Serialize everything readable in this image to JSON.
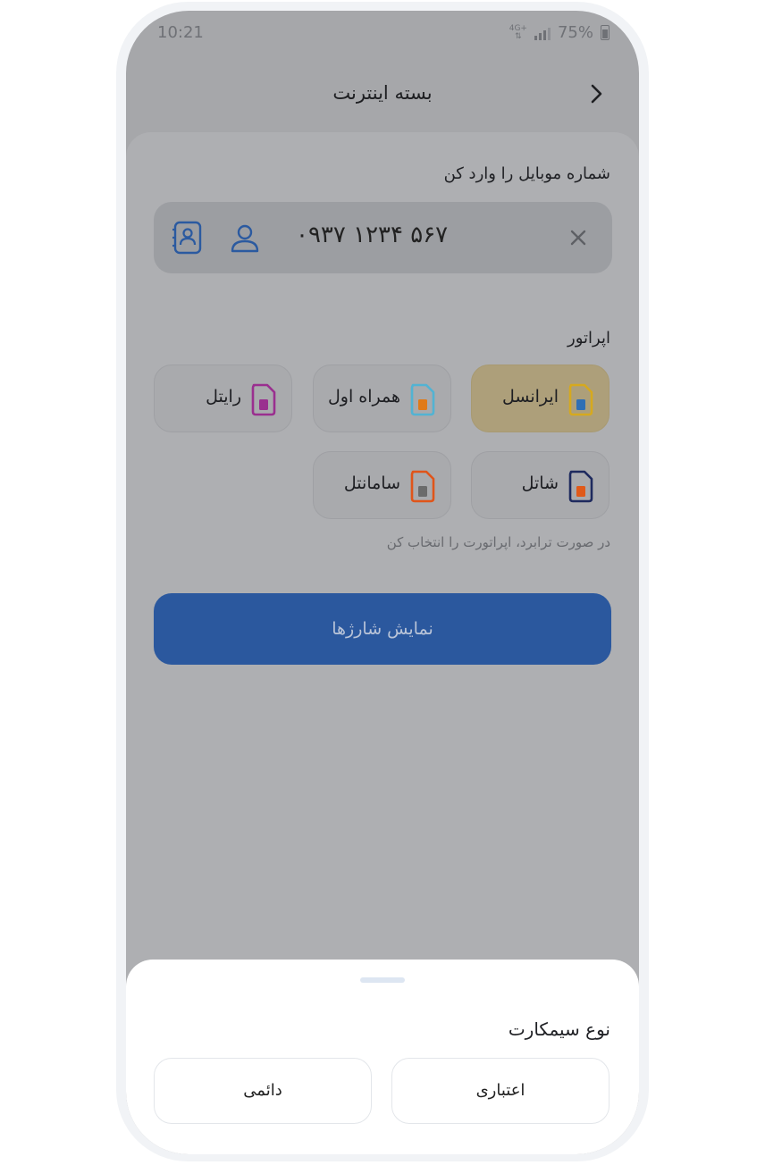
{
  "status_bar": {
    "time": "10:21",
    "network": "4G+",
    "battery": "75%"
  },
  "header": {
    "title": "بسته اینترنت"
  },
  "phone_section": {
    "label": "شماره موبایل را وارد کن",
    "value": "۰۹۳۷ ۱۲۳۴ ۵۶۷"
  },
  "operator_section": {
    "label": "اپراتور",
    "operators": [
      {
        "name": "ایرانسل",
        "selected": true,
        "icon_color": "#d6a91e",
        "chip_color": "#2f6fb5"
      },
      {
        "name": "همراه اول",
        "selected": false,
        "icon_color": "#52b3d3",
        "chip_color": "#e07a18"
      },
      {
        "name": "رایتل",
        "selected": false,
        "icon_color": "#9a2f8f",
        "chip_color": "#9a2f8f"
      },
      {
        "name": "شاتل",
        "selected": false,
        "icon_color": "#1e2a5e",
        "chip_color": "#e05a1a"
      },
      {
        "name": "سامانتل",
        "selected": false,
        "icon_color": "#e0551a",
        "chip_color": "#6b6b6b"
      }
    ],
    "hint": "در صورت ترابرد، اپراتورت را انتخاب کن"
  },
  "submit_button": {
    "label": "نمایش شارژها"
  },
  "bottom_sheet": {
    "title": "نوع سیمکارت",
    "options": [
      "اعتباری",
      "دائمی"
    ]
  }
}
